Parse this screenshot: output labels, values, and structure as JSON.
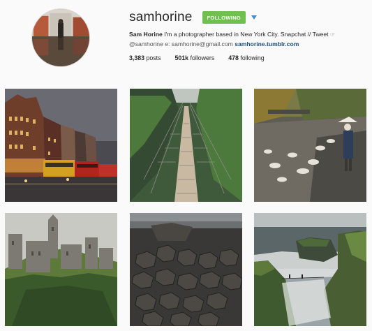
{
  "profile": {
    "username": "samhorine",
    "follow_label": "FOLLOWING",
    "full_name": "Sam Horine",
    "bio_text": "I'm a photographer based in New York City. Snapchat // Tweet",
    "bio_line2_prefix": "@samhorine e: samhorine@gmail.com",
    "website": "samhorine.tumblr.com"
  },
  "stats": {
    "posts_count": "3,383",
    "posts_label": "posts",
    "followers_count": "501k",
    "followers_label": "followers",
    "following_count": "478",
    "following_label": "following"
  },
  "colors": {
    "follow_button": "#70c050",
    "link": "#1e4e7e",
    "caret": "#3f8cd8"
  },
  "icons": {
    "caret": "caret-down-icon",
    "hand": "hand-icon"
  }
}
